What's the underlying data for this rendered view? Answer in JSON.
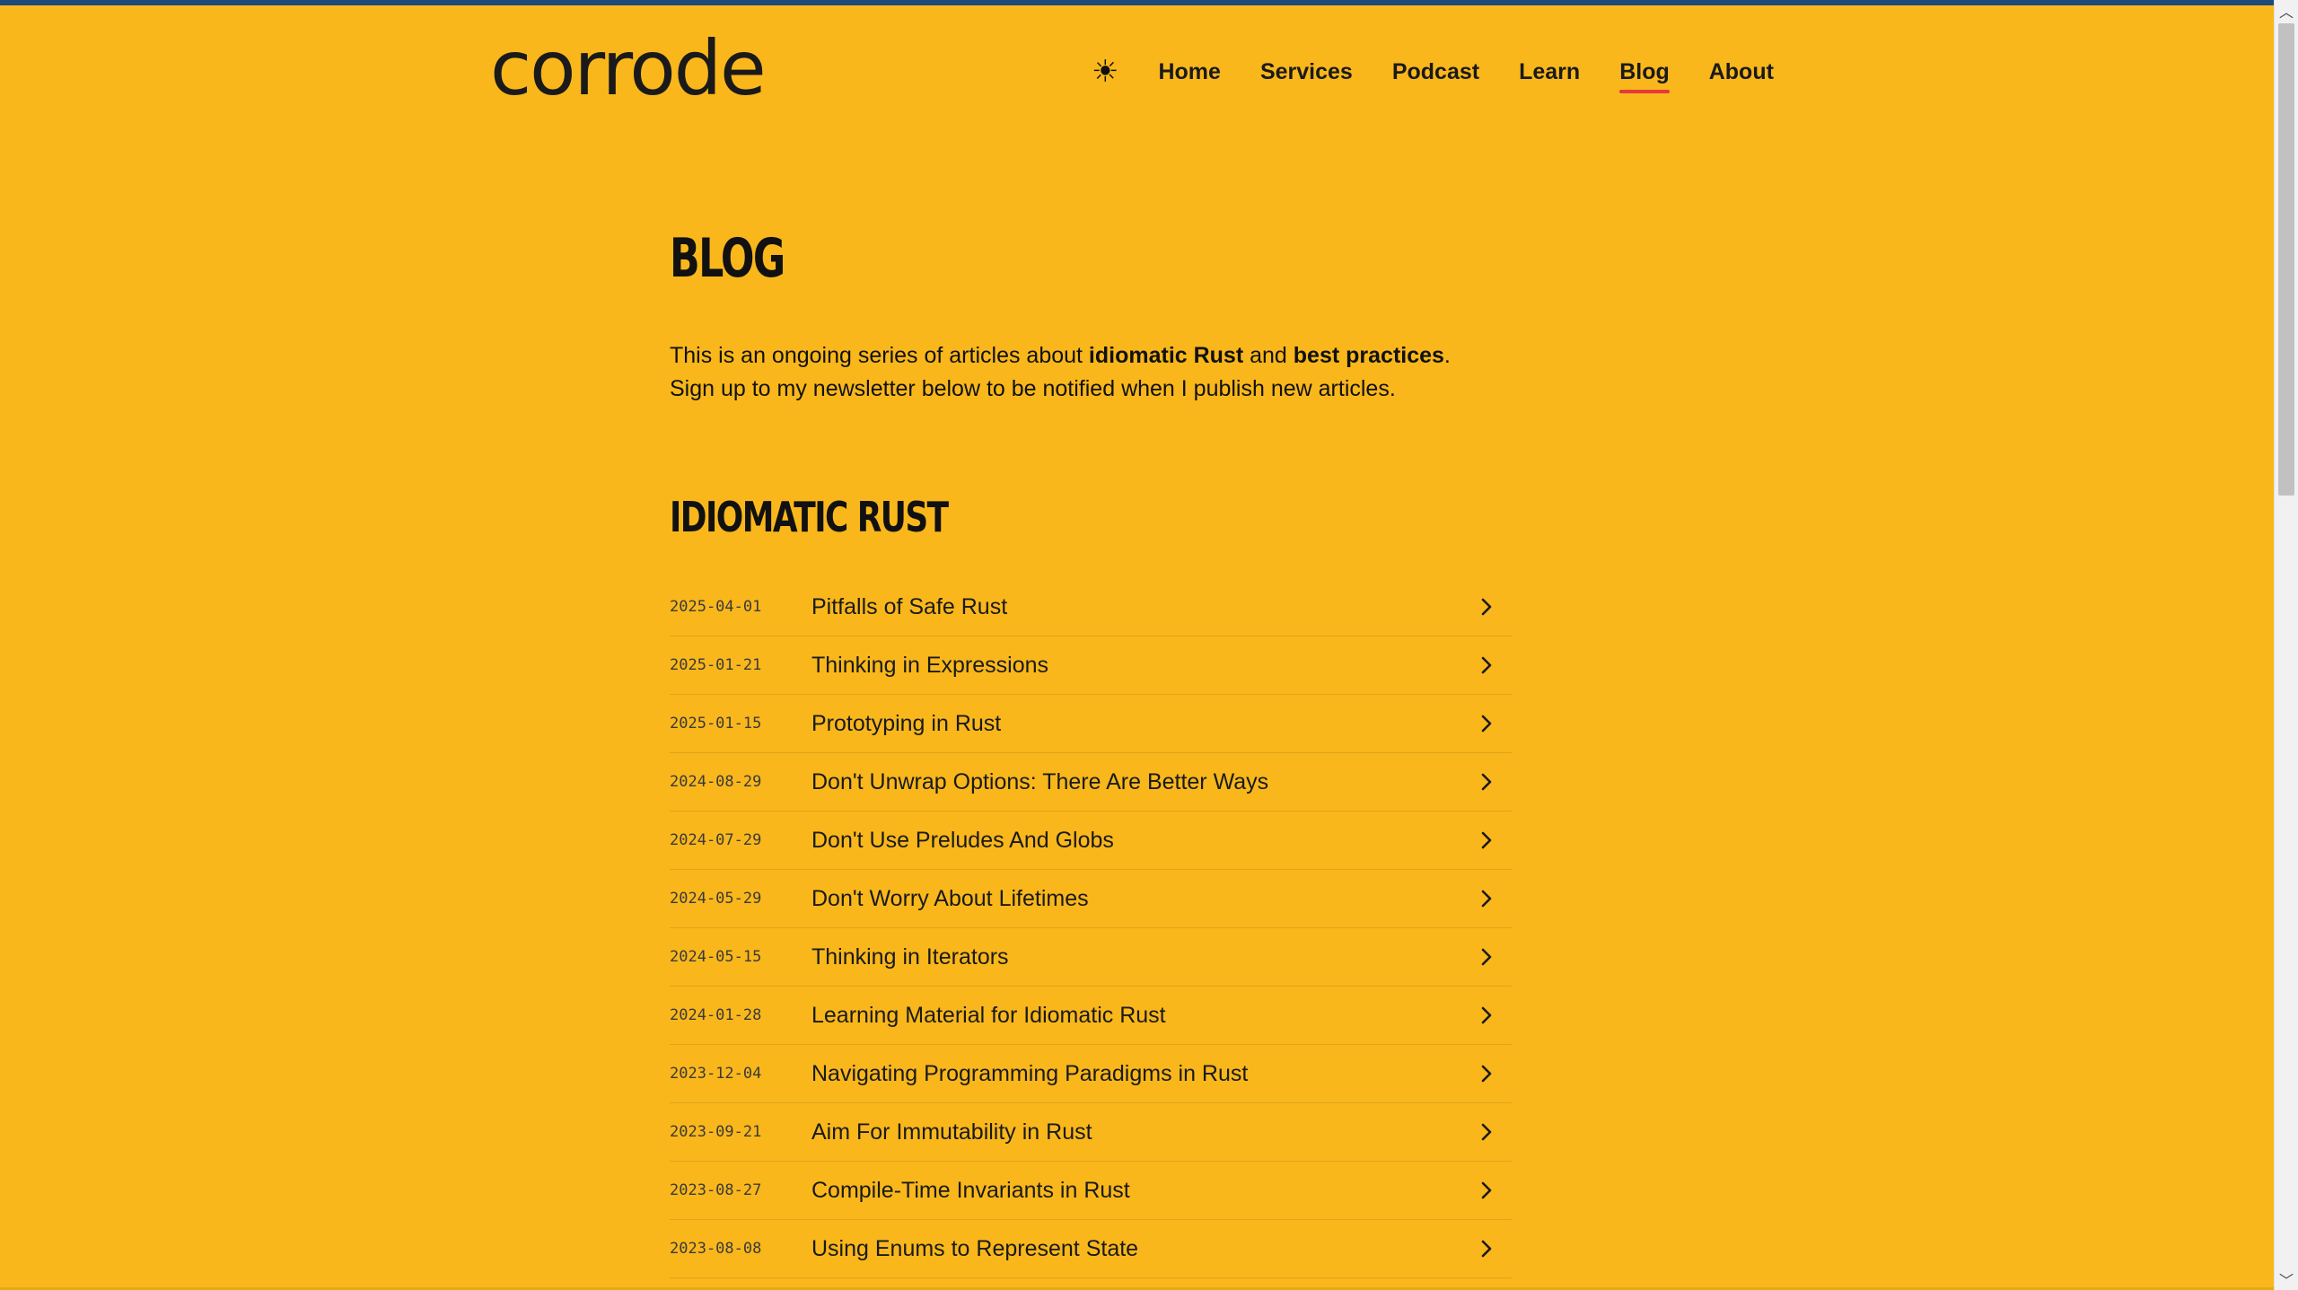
{
  "site": {
    "logo": "corrode"
  },
  "nav": {
    "theme_icon": "sun-icon",
    "theme_glyph": "☀",
    "items": [
      {
        "label": "Home"
      },
      {
        "label": "Services"
      },
      {
        "label": "Podcast"
      },
      {
        "label": "Learn"
      },
      {
        "label": "Blog",
        "active": true
      },
      {
        "label": "About"
      }
    ]
  },
  "page": {
    "title": "BLOG",
    "intro": {
      "part1": "This is an ongoing series of articles about ",
      "bold1": "idiomatic Rust",
      "part2": " and ",
      "bold2": "best practices",
      "part3": ".",
      "line2": "Sign up to my newsletter below to be notified when I publish new articles."
    }
  },
  "section": {
    "title": "IDIOMATIC RUST",
    "posts": [
      {
        "date": "2025-04-01",
        "title": "Pitfalls of Safe Rust"
      },
      {
        "date": "2025-01-21",
        "title": "Thinking in Expressions"
      },
      {
        "date": "2025-01-15",
        "title": "Prototyping in Rust"
      },
      {
        "date": "2024-08-29",
        "title": "Don't Unwrap Options: There Are Better Ways"
      },
      {
        "date": "2024-07-29",
        "title": "Don't Use Preludes And Globs"
      },
      {
        "date": "2024-05-29",
        "title": "Don't Worry About Lifetimes"
      },
      {
        "date": "2024-05-15",
        "title": "Thinking in Iterators"
      },
      {
        "date": "2024-01-28",
        "title": "Learning Material for Idiomatic Rust"
      },
      {
        "date": "2023-12-04",
        "title": "Navigating Programming Paradigms in Rust"
      },
      {
        "date": "2023-09-21",
        "title": "Aim For Immutability in Rust"
      },
      {
        "date": "2023-08-27",
        "title": "Compile-Time Invariants in Rust"
      },
      {
        "date": "2023-08-08",
        "title": "Using Enums to Represent State"
      }
    ]
  },
  "colors": {
    "background": "#f9b71b",
    "top_bar": "#1c4a7c",
    "active_underline": "#e5383b"
  }
}
